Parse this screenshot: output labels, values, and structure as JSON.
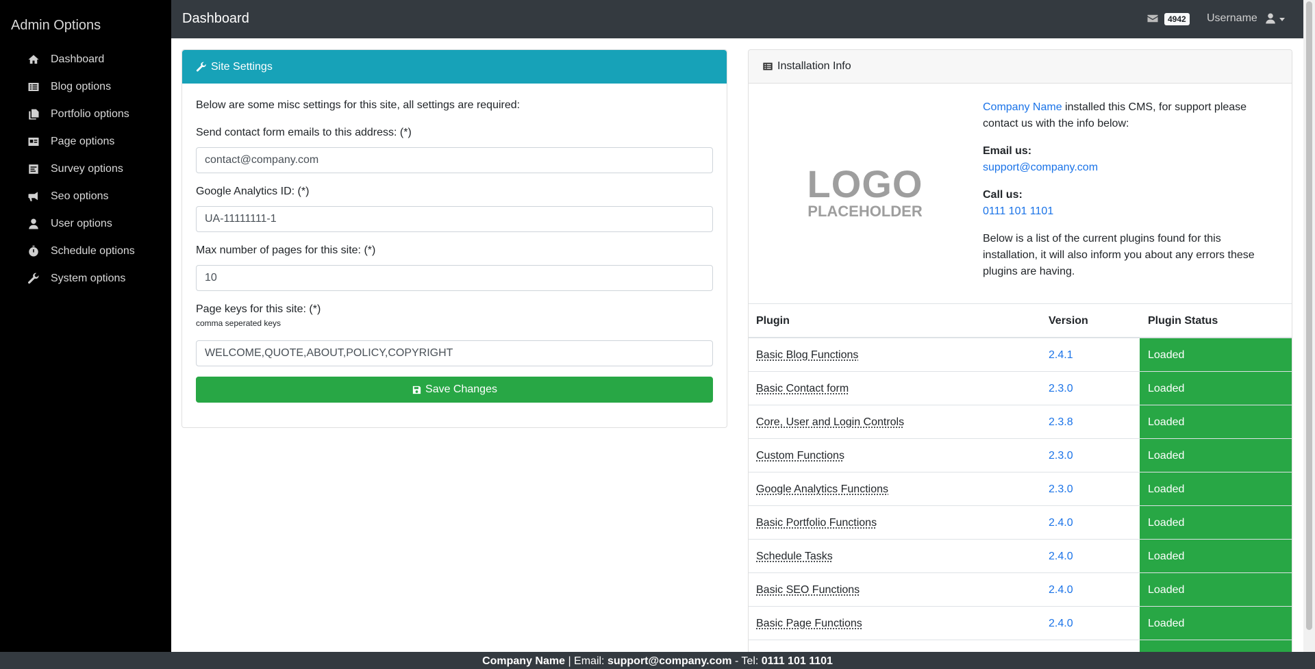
{
  "sidebar": {
    "title": "Admin Options",
    "items": [
      {
        "label": "Dashboard",
        "icon": "home-icon"
      },
      {
        "label": "Blog options",
        "icon": "list-icon"
      },
      {
        "label": "Portfolio options",
        "icon": "copy-icon"
      },
      {
        "label": "Page options",
        "icon": "id-card-icon"
      },
      {
        "label": "Survey options",
        "icon": "poll-icon"
      },
      {
        "label": "Seo options",
        "icon": "bullhorn-icon"
      },
      {
        "label": "User options",
        "icon": "user-icon"
      },
      {
        "label": "Schedule options",
        "icon": "stopwatch-icon"
      },
      {
        "label": "System options",
        "icon": "wrench-icon"
      }
    ]
  },
  "topbar": {
    "title": "Dashboard",
    "mail_count": "4942",
    "username": "Username"
  },
  "settings": {
    "header": "Site Settings",
    "intro": "Below are some misc settings for this site, all settings are required:",
    "email_label": "Send contact form emails to this address: (*)",
    "email_value": "contact@company.com",
    "ga_label": "Google Analytics ID: (*)",
    "ga_value": "UA-11111111-1",
    "maxpages_label": "Max number of pages for this site: (*)",
    "maxpages_value": "10",
    "keys_label": "Page keys for this site: (*)",
    "keys_help": "comma seperated keys",
    "keys_value": "WELCOME,QUOTE,ABOUT,POLICY,COPYRIGHT",
    "save_label": "Save Changes"
  },
  "install": {
    "header": "Installation Info",
    "logo_line1": "LOGO",
    "logo_line2": "PLACEHOLDER",
    "company_link": "Company Name",
    "intro_rest": " installed this CMS, for support please contact us with the info below:",
    "email_heading": "Email us:",
    "email": "support@company.com",
    "call_heading": "Call us:",
    "phone": "0111 101 1101",
    "plugins_note": "Below is a list of the current plugins found for this installation, it will also inform you about any errors these plugins are having.",
    "table": {
      "headers": [
        "Plugin",
        "Version",
        "Plugin Status"
      ],
      "rows": [
        {
          "name": "Basic Blog Functions",
          "version": "2.4.1",
          "status": "Loaded"
        },
        {
          "name": "Basic Contact form",
          "version": "2.3.0",
          "status": "Loaded"
        },
        {
          "name": "Core, User and Login Controls",
          "version": "2.3.8",
          "status": "Loaded"
        },
        {
          "name": "Custom Functions",
          "version": "2.3.0",
          "status": "Loaded"
        },
        {
          "name": "Google Analytics Functions",
          "version": "2.3.0",
          "status": "Loaded"
        },
        {
          "name": "Basic Portfolio Functions",
          "version": "2.4.0",
          "status": "Loaded"
        },
        {
          "name": "Schedule Tasks",
          "version": "2.4.0",
          "status": "Loaded"
        },
        {
          "name": "Basic SEO Functions",
          "version": "2.4.0",
          "status": "Loaded"
        },
        {
          "name": "Basic Page Functions",
          "version": "2.4.0",
          "status": "Loaded"
        }
      ]
    }
  },
  "footer": {
    "company": "Company Name",
    "email_label": " | Email: ",
    "email": "support@company.com",
    "tel_label": " - Tel: ",
    "phone": "0111 101 1101"
  },
  "colors": {
    "sidebar_bg": "#000000",
    "topbar_bg": "#343a40",
    "header_accent": "#17a2b8",
    "success": "#28a745",
    "link": "#1a73e8"
  }
}
